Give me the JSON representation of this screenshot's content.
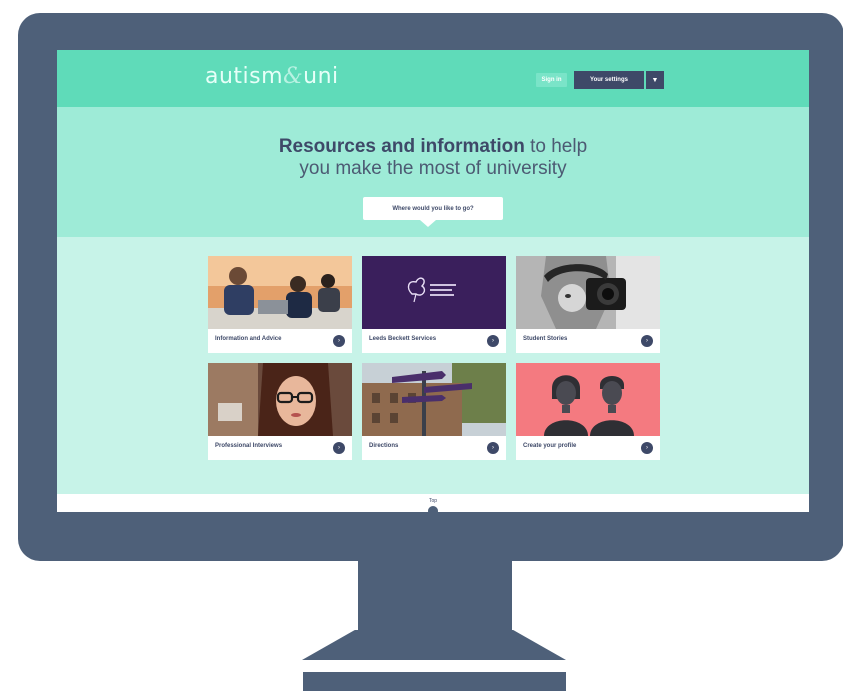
{
  "logo": {
    "part1": "autism",
    "amp": "&",
    "part2": "uni"
  },
  "header": {
    "sign_in": "Sign in",
    "settings": "Your settings",
    "settings_caret": "▼"
  },
  "hero": {
    "title_bold": "Resources and information",
    "title_rest": " to help",
    "title_line2": "you make the most of university",
    "where_prompt": "Where would you like to go?"
  },
  "cards": [
    {
      "label": "Information and Advice",
      "arrow": "›"
    },
    {
      "label": "Leeds Beckett Services",
      "arrow": "›"
    },
    {
      "label": "Student Stories",
      "arrow": "›"
    },
    {
      "label": "Professional Interviews",
      "arrow": "›"
    },
    {
      "label": "Directions",
      "arrow": "›"
    },
    {
      "label": "Create your profile",
      "arrow": "›"
    }
  ],
  "footer": {
    "top_label": "Top"
  },
  "colors": {
    "monitor": "#4e6079",
    "header": "#5fdbb9",
    "hero": "#9eebd7",
    "page": "#c7f3e8",
    "navy": "#3e4968"
  }
}
